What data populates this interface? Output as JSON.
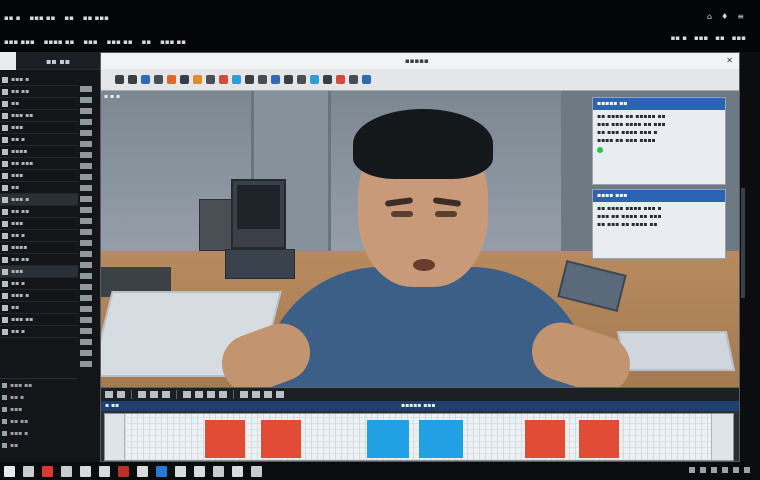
{
  "top_menu": {
    "row1": [
      "▪▪ ▪",
      "▪▪▪ ▪▪",
      "▪▪",
      "▪▪ ▪▪▪"
    ],
    "row2": [
      "▪▪▪ ▪▪▪",
      "▪▪▪▪ ▪▪",
      "▪▪▪",
      "▪▪▪ ▪▪",
      "▪▪",
      "▪▪▪ ▪▪"
    ],
    "right_glyphs": [
      "⌂",
      "♦",
      "≡"
    ],
    "tabs": [
      "▪▪ ▪",
      "▪▪▪",
      "▪▪",
      "▪▪▪"
    ]
  },
  "left_panel": {
    "header_label": "▪▪ ▪▪",
    "items": [
      "▪▪▪ ▪",
      "▪▪ ▪▪",
      "▪▪",
      "▪▪▪ ▪▪",
      "▪▪▪",
      "▪▪ ▪",
      "▪▪▪▪",
      "▪▪ ▪▪▪",
      "▪▪▪",
      "▪▪",
      "▪▪▪ ▪",
      "▪▪ ▪▪",
      "▪▪▪",
      "▪▪ ▪",
      "▪▪▪▪",
      "▪▪ ▪▪",
      "▪▪▪",
      "▪▪ ▪",
      "▪▪▪ ▪",
      "▪▪",
      "▪▪▪ ▪▪",
      "▪▪ ▪"
    ],
    "footer_items": [
      "▪▪▪ ▪▪",
      "▪▪ ▪",
      "▪▪▪",
      "▪▪ ▪▪",
      "▪▪▪ ▪",
      "▪▪"
    ]
  },
  "window": {
    "title": "▪▪▪▪▪",
    "viewport_corner": "▪ ▪ ▪",
    "close_glyph": "✕"
  },
  "info_panels": [
    {
      "header": "▪▪▪▪▪ ▪▪",
      "lines": [
        "▪▪ ▪▪▪▪ ▪▪ ▪▪▪▪▪ ▪▪",
        "▪▪▪ ▪▪▪ ▪▪▪▪ ▪▪ ▪▪▪",
        "▪▪ ▪▪▪ ▪▪▪▪ ▪▪▪ ▪",
        "▪▪▪▪ ▪▪ ▪▪▪ ▪▪▪▪"
      ]
    },
    {
      "header": "▪▪▪▪ ▪▪▪",
      "lines": [
        "▪▪ ▪▪▪▪ ▪▪▪▪ ▪▪▪ ▪",
        "▪▪▪ ▪▪ ▪▪▪▪ ▪▪ ▪▪▪",
        "▪▪ ▪▪▪ ▪▪ ▪▪▪▪ ▪▪"
      ]
    }
  ],
  "timeline": {
    "header_left": "▪ ▪▪",
    "header_mid": "▪▪▪▪▪ ▪▪▪",
    "clip_color_red": "#e24b35",
    "clip_color_blue": "#21a0e3"
  },
  "colors": {
    "accent_blue": "#2c64b5",
    "timeline_red": "#e24b35",
    "timeline_blue": "#21a0e3"
  }
}
